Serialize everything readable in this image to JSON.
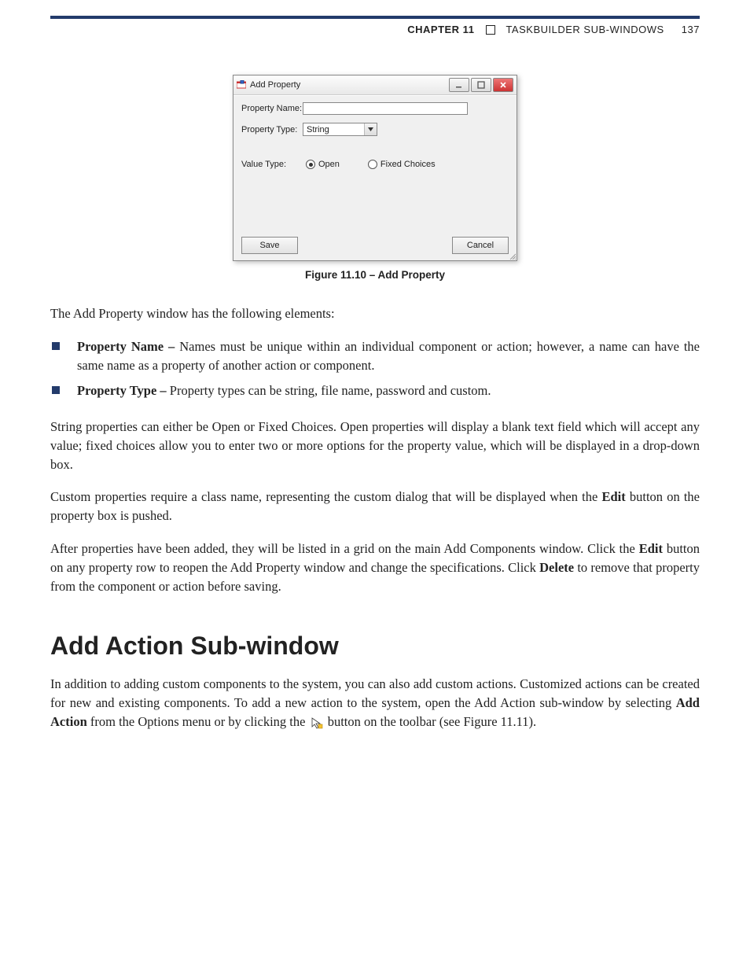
{
  "header": {
    "chapter_label": "CHAPTER 11",
    "chapter_title": "TASKBUILDER SUB-WINDOWS",
    "page_number": "137"
  },
  "figure": {
    "window_title": "Add Property",
    "fields": {
      "property_name_label": "Property Name:",
      "property_name_value": "",
      "property_type_label": "Property Type:",
      "property_type_value": "String",
      "value_type_label": "Value Type:",
      "open_label": "Open",
      "fixed_choices_label": "Fixed Choices"
    },
    "buttons": {
      "save": "Save",
      "cancel": "Cancel"
    },
    "caption": "Figure 11.10 – Add Property"
  },
  "intro_text": "The Add Property window has the following elements:",
  "bullets": {
    "name_label": "Property Name –",
    "name_text": " Names must be unique within an individual component or action; however, a name can have the same name as a property of another action or component.",
    "type_label": "Property Type –",
    "type_text": " Property types can be string, file name, password and custom."
  },
  "paragraphs": {
    "p1": "String properties can either be Open or Fixed Choices. Open properties will display a blank text field which will accept any value; fixed choices allow you to enter two or more options for the property value, which will be displayed in a drop-down box.",
    "p2a": "Custom properties require a class name, representing the custom dialog that will be displayed when the ",
    "p2_edit": "Edit",
    "p2b": " button on the property box is pushed.",
    "p3a": "After properties have been added, they will be listed in a grid on the main Add Components window. Click the ",
    "p3_edit": "Edit",
    "p3b": " button on any property row to reopen the Add Property window and change the specifications. Click ",
    "p3_delete": "Delete",
    "p3c": " to remove that property from the component or action before saving."
  },
  "section_heading": "Add Action Sub-window",
  "section_paragraph": {
    "a": "In addition to adding custom components to the system, you can also add custom actions. Customized actions can be created for new and existing components. To add a new action to the system, open the Add Action sub-window by selecting ",
    "add_action": "Add Action",
    "b": " from the Options menu or by clicking the ",
    "c": " button on the toolbar (see Figure 11.11)."
  }
}
